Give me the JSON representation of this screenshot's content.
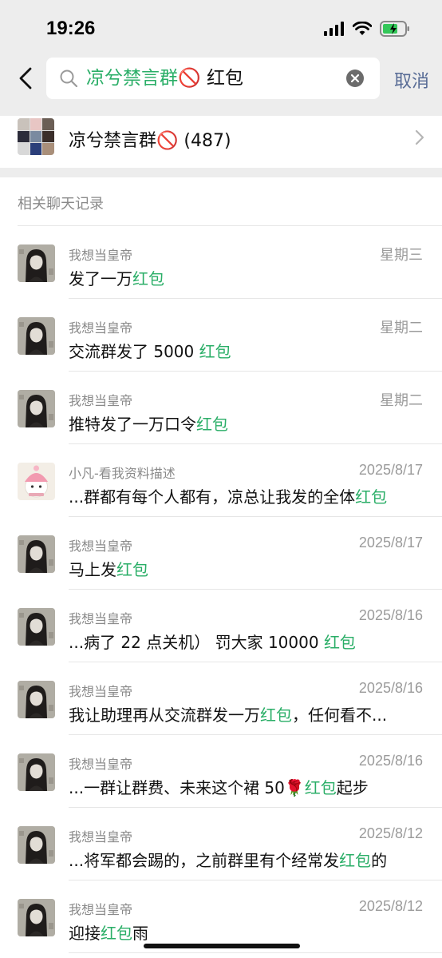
{
  "status_bar": {
    "time": "19:26"
  },
  "search": {
    "query_group": "凉兮禁言群🚫",
    "query_keyword": " 红包",
    "cancel_label": "取消"
  },
  "group_result": {
    "name": "凉兮禁言群🚫 (487)"
  },
  "section": {
    "title": "相关聊天记录"
  },
  "colors": {
    "highlight": "#2aae67",
    "link": "#576b95",
    "secondary_text": "#8a8a8a"
  },
  "messages": [
    {
      "sender": "我想当皇帝",
      "date": "星期三",
      "pre": "发了一万",
      "hl": "红包",
      "post": "",
      "avatar": "dark-girl"
    },
    {
      "sender": "我想当皇帝",
      "date": "星期二",
      "pre": "交流群发了 5000 ",
      "hl": "红包",
      "post": "",
      "avatar": "dark-girl"
    },
    {
      "sender": "我想当皇帝",
      "date": "星期二",
      "pre": "推特发了一万口令",
      "hl": "红包",
      "post": "",
      "avatar": "dark-girl"
    },
    {
      "sender": "小凡-看我资料描述",
      "date": "2025/8/17",
      "pre": "...群都有每个人都有，凉总让我发的全体",
      "hl": "红包",
      "post": "",
      "avatar": "cartoon-pink-hat"
    },
    {
      "sender": "我想当皇帝",
      "date": "2025/8/17",
      "pre": "马上发",
      "hl": "红包",
      "post": "",
      "avatar": "dark-girl"
    },
    {
      "sender": "我想当皇帝",
      "date": "2025/8/16",
      "pre": "...病了 22 点关机） 罚大家 10000 ",
      "hl": "红包",
      "post": "",
      "avatar": "dark-girl"
    },
    {
      "sender": "我想当皇帝",
      "date": "2025/8/16",
      "pre": "我让助理再从交流群发一万",
      "hl": "红包",
      "post": "，任何看不...",
      "avatar": "dark-girl"
    },
    {
      "sender": "我想当皇帝",
      "date": "2025/8/16",
      "pre": "...一群让群费、未来这个裙 50🌹",
      "hl": "红包",
      "post": "起步",
      "avatar": "dark-girl"
    },
    {
      "sender": "我想当皇帝",
      "date": "2025/8/12",
      "pre": "...将军都会踢的，之前群里有个经常发",
      "hl": "红包",
      "post": "的",
      "avatar": "dark-girl"
    },
    {
      "sender": "我想当皇帝",
      "date": "2025/8/12",
      "pre": "迎接",
      "hl": "红包",
      "post": "雨",
      "avatar": "dark-girl"
    }
  ]
}
